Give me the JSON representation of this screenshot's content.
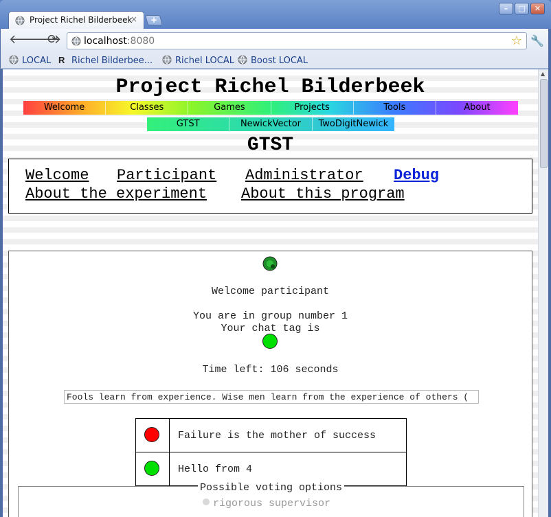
{
  "browser": {
    "tab_title": "Project Richel Bilderbeek",
    "tab_close": "×",
    "new_tab": "+",
    "url_host": "localhost",
    "url_port": ":8080",
    "bookmarks": [
      "LOCAL",
      "Richel Bilderbee...",
      "Richel LOCAL",
      "Boost LOCAL"
    ]
  },
  "site": {
    "title": "Project Richel Bilderbeek",
    "menu": [
      "Welcome",
      "Classes",
      "Games",
      "Projects",
      "Tools",
      "About"
    ],
    "submenu": [
      "GTST",
      "NewickVector",
      "TwoDigitNewick"
    ]
  },
  "page": {
    "title": "GTST",
    "nav_links": [
      "Welcome",
      "Participant",
      "Administrator",
      "Debug",
      "About the experiment",
      "About this program"
    ],
    "active_link": "Debug"
  },
  "participant": {
    "welcome": "Welcome participant",
    "group_text": "You are in group number 1",
    "chat_tag_text": "Your chat tag is",
    "time_left": "Time left: 106 seconds",
    "quote": "Fools learn from experience. Wise men learn from the experience of others (",
    "chat_messages": [
      {
        "text": "Failure is the mother of success",
        "color": "#ff0000"
      },
      {
        "text": "Hello from 4",
        "color": "#00e000"
      }
    ],
    "voting_legend": "Possible voting options",
    "voting_options": [
      "rigorous supervisor"
    ],
    "chat_tag_color": "#00e000"
  }
}
